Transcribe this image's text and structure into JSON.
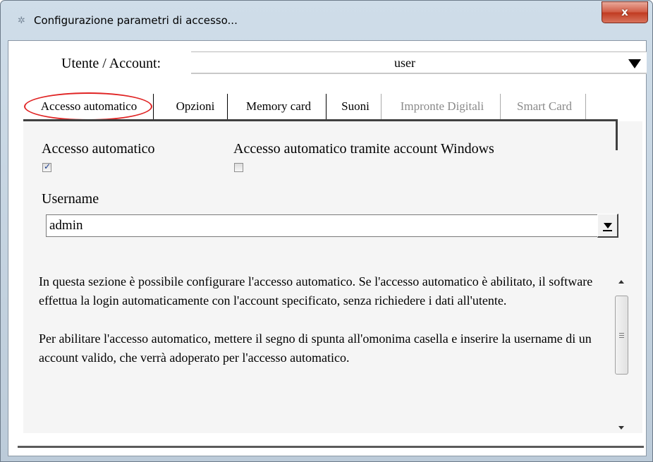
{
  "window": {
    "title": "Configurazione parametri di accesso...",
    "close_label": "x"
  },
  "account": {
    "label": "Utente / Account:",
    "value": "user"
  },
  "tabs": [
    {
      "label": "Accesso automatico",
      "active": true,
      "enabled": true
    },
    {
      "label": "Opzioni",
      "enabled": true
    },
    {
      "label": "Memory card",
      "enabled": true
    },
    {
      "label": "Suoni",
      "enabled": true
    },
    {
      "label": "Impronte Digitali",
      "enabled": false
    },
    {
      "label": "Smart Card",
      "enabled": false
    }
  ],
  "panel": {
    "auto_access": {
      "label": "Accesso automatico",
      "checked": true
    },
    "windows_access": {
      "label": "Accesso automatico tramite account Windows",
      "checked": false
    },
    "username": {
      "label": "Username",
      "value": "admin"
    },
    "help_paragraphs": [
      "In questa sezione è possibile configurare l'accesso automatico. Se l'accesso automatico è abilitato, il software effettua la login automaticamente con l'account specificato, senza richiedere i dati all'utente.",
      "Per abilitare l'accesso automatico, mettere il segno di spunta all'omonima casella e inserire la username di un account valido, che verrà adoperato per l'accesso automatico."
    ]
  },
  "colors": {
    "highlight_ring": "#e02424",
    "close_button": "#c03a20",
    "disabled_text": "#8a8a8a"
  }
}
